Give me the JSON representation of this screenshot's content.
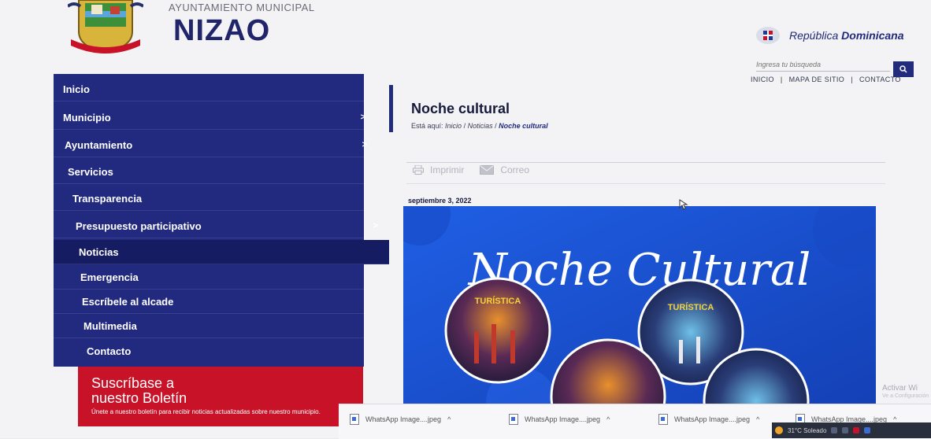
{
  "header": {
    "org_superscript": "AYUNTAMIENTO MUNICIPAL",
    "org_name": "NIZAO",
    "country_prefix": "República ",
    "country_bold": "Dominicana",
    "search_placeholder": "Ingresa tu búsqueda",
    "links": [
      "INICIO",
      "|",
      "MAPA DE SITIO",
      "|",
      "CONTACTO"
    ]
  },
  "sidebar": {
    "items": [
      {
        "label": "Inicio",
        "has_submenu": false
      },
      {
        "label": "Municipio",
        "has_submenu": true
      },
      {
        "label": "Ayuntamiento",
        "has_submenu": true
      },
      {
        "label": "Servicios",
        "has_submenu": false
      },
      {
        "label": "Transparencia",
        "has_submenu": false
      },
      {
        "label": "Presupuesto participativo",
        "has_submenu": true
      },
      {
        "label": "Noticias",
        "has_submenu": false,
        "active": true
      },
      {
        "label": "Emergencia",
        "has_submenu": false
      },
      {
        "label": "Escríbele al alcade",
        "has_submenu": false
      },
      {
        "label": "Multimedia",
        "has_submenu": false
      },
      {
        "label": "Contacto",
        "has_submenu": false
      }
    ],
    "chevron": ">"
  },
  "newsletter": {
    "title_line1": "Suscríbase a",
    "title_line2": "nuestro Boletín",
    "text": "Únete a nuestro boletín para recibir noticias actualizadas sobre nuestro municipio."
  },
  "article": {
    "title": "Noche cultural",
    "breadcrumb_prefix": "Está aquí:",
    "breadcrumb": [
      "Inicio",
      "Noticias",
      "Noche cultural"
    ],
    "separator": "/",
    "tool_print": "Imprimir",
    "tool_email": "Correo",
    "date": "septiembre 3, 2022",
    "banner_text": "Noche Cultural",
    "stage_sign": "TURÍSTICA"
  },
  "windows": {
    "activate": "Activar Wi",
    "activate_sub": "Ve a Configuración",
    "downloads": [
      "WhatsApp Image....jpeg",
      "WhatsApp Image....jpeg",
      "WhatsApp Image....jpeg",
      "WhatsApp Image....jpeg"
    ],
    "caret": "^",
    "weather": "31°C  Soleado"
  },
  "colors": {
    "nav_blue": "#222a80",
    "nav_active": "#151c62",
    "newsletter_red": "#c81227",
    "banner_blue": "#1d55d8"
  }
}
